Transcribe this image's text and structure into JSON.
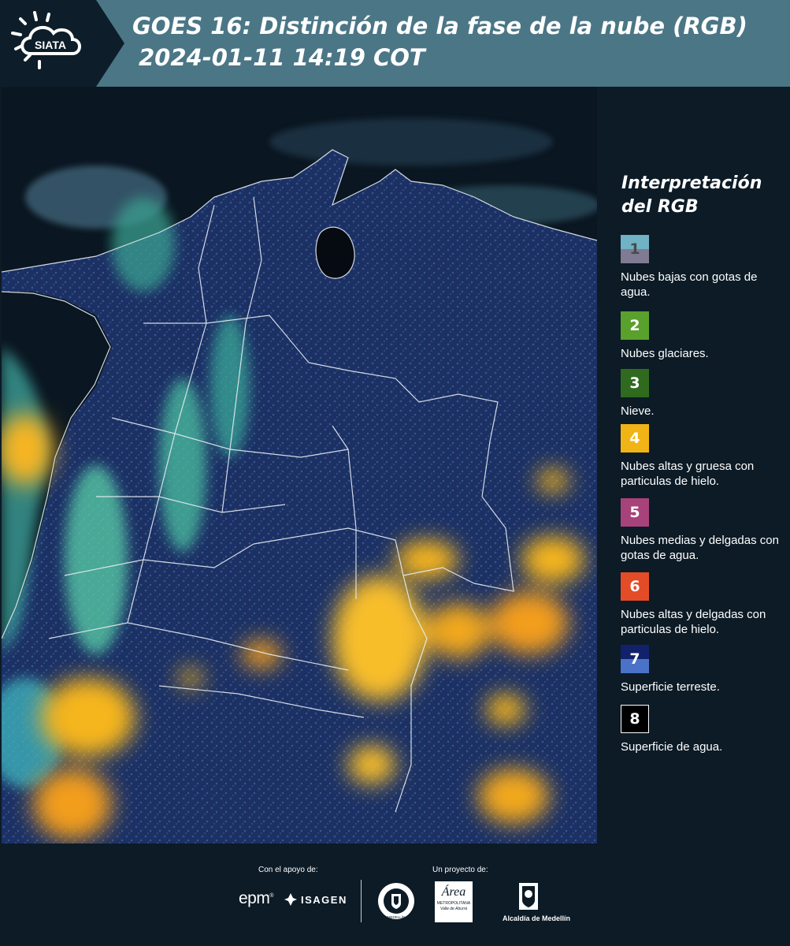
{
  "header": {
    "logo_text": "SIATA",
    "title": "GOES 16: Distinción de la fase de la nube (RGB)",
    "datetime": "2024-01-11 14:19 COT"
  },
  "legend": {
    "title_line1": "Interpretación",
    "title_line2": "del RGB",
    "items": [
      {
        "number": "1",
        "label": "Nubes bajas con gotas de agua.",
        "color_top": "#6fb3c4",
        "color_bottom": "#807a93",
        "text_color": "#4a4a4a"
      },
      {
        "number": "2",
        "label": "Nubes glaciares.",
        "color_top": "#5aa02c",
        "color_bottom": "#5aa02c",
        "text_color": "#ffffff"
      },
      {
        "number": "3",
        "label": "Nieve.",
        "color_top": "#2f6a1e",
        "color_bottom": "#2f6a1e",
        "text_color": "#ffffff"
      },
      {
        "number": "4",
        "label": "Nubes altas y gruesa con particulas de hielo.",
        "color_top": "#f0b416",
        "color_bottom": "#f0b416",
        "text_color": "#ffffff"
      },
      {
        "number": "5",
        "label": "Nubes medias y delgadas con gotas de agua.",
        "color_top": "#a8427a",
        "color_bottom": "#a8427a",
        "text_color": "#ffffff"
      },
      {
        "number": "6",
        "label": "Nubes altas y delgadas con particulas de hielo.",
        "color_top": "#e44c27",
        "color_bottom": "#e44c27",
        "text_color": "#ffffff"
      },
      {
        "number": "7",
        "label": "Superficie terreste.",
        "color_top": "#12216b",
        "color_bottom": "#4a72c8",
        "text_color": "#ffffff"
      },
      {
        "number": "8",
        "label": "Superficie de agua.",
        "color_top": "#000000",
        "color_bottom": "#000000",
        "text_color": "#ffffff",
        "border": "#ffffff"
      }
    ]
  },
  "footer": {
    "support_caption": "Con el apoyo de:",
    "project_caption": "Un proyecto de:",
    "sponsor_epm": "epm",
    "sponsor_isagen": "ISAGEN",
    "org_area_name": "Área",
    "org_area_line1": "METROPOLITANA",
    "org_area_line2": "Valle de Aburrá",
    "org_alcaldia": "Alcaldía de Medellín",
    "org_seal_text": "MEDELLÍN"
  },
  "colors": {
    "header_bg": "#4b7686",
    "logo_bg": "#0d1e2a",
    "panel_bg": "#0c1b26",
    "land": "#1a2d5a",
    "water": "#0a1621",
    "boundary": "#e8eef2",
    "cloud_high_thick": "#f5b51c",
    "cloud_glacial": "#5ad0a8"
  }
}
